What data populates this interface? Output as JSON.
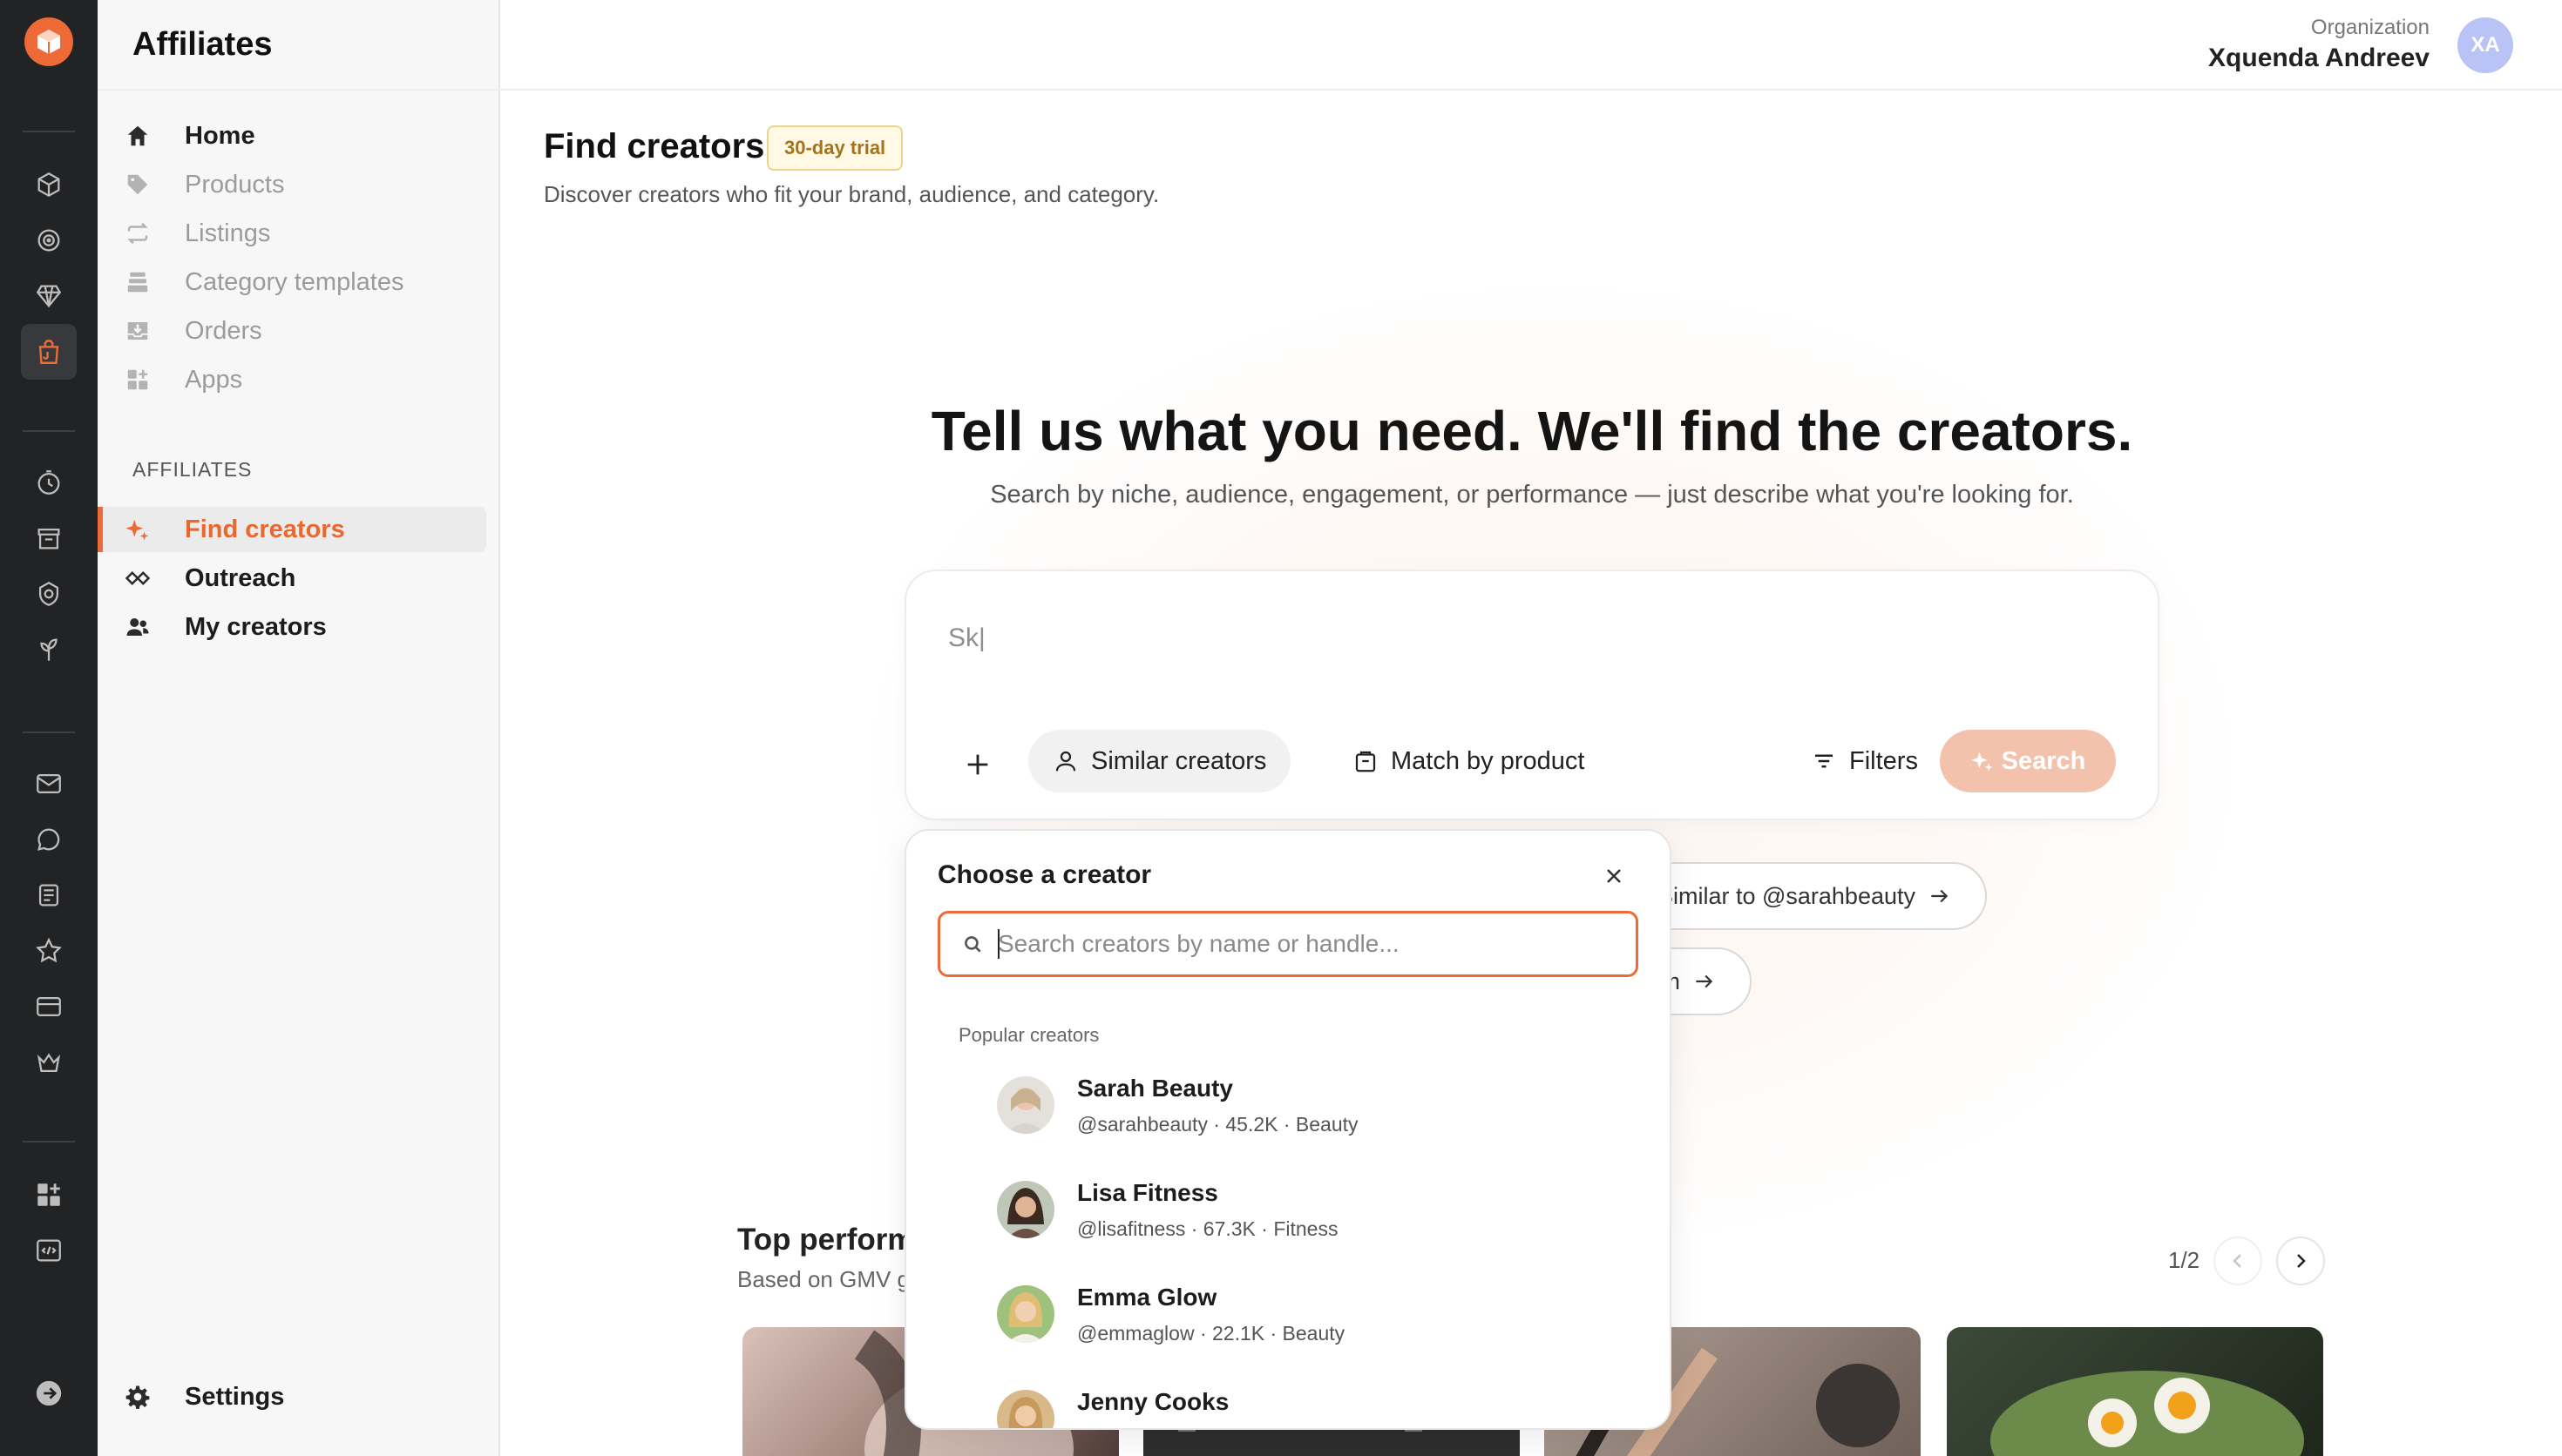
{
  "app": {
    "title": "Affiliates"
  },
  "header": {
    "org_label": "Organization",
    "org_name": "Xquenda Andreev",
    "avatar_initials": "XA"
  },
  "rail": {
    "icons": [
      "box-icon",
      "target-icon",
      "gem-icon",
      "shopping-bag-icon",
      "clock-icon",
      "archive-icon",
      "shield-icon",
      "plant-icon",
      "mail-icon",
      "chat-icon",
      "document-icon",
      "star-icon",
      "card-icon",
      "crown-icon",
      "apps-add-icon",
      "code-icon",
      "logout-icon"
    ],
    "active": "shopping-bag-icon"
  },
  "sidebar": {
    "items": [
      {
        "label": "Home",
        "icon": "home-icon"
      },
      {
        "label": "Products",
        "icon": "tag-icon"
      },
      {
        "label": "Listings",
        "icon": "repeat-icon"
      },
      {
        "label": "Category templates",
        "icon": "layers-icon"
      },
      {
        "label": "Orders",
        "icon": "inbox-icon"
      },
      {
        "label": "Apps",
        "icon": "apps-icon"
      }
    ],
    "section_label": "AFFILIATES",
    "affiliate_items": [
      {
        "label": "Find creators",
        "icon": "sparkle-icon",
        "active": true
      },
      {
        "label": "Outreach",
        "icon": "handshake-icon"
      },
      {
        "label": "My creators",
        "icon": "users-icon"
      }
    ],
    "settings_label": "Settings"
  },
  "main": {
    "title": "Find creators",
    "trial_badge": "30-day trial",
    "subtitle": "Discover creators who fit your brand, audience, and category.",
    "hero_title": "Tell us what you need. We'll find the creators.",
    "hero_subtitle": "Search by niche, audience, engagement, or performance — just describe what you're looking for.",
    "search": {
      "value": "Sk|",
      "chip_similar": "Similar creators",
      "chip_match": "Match by product",
      "filters_label": "Filters",
      "search_label": "Search"
    },
    "suggestions": [
      "Similar to @sarahbeauty",
      "m"
    ],
    "top": {
      "title": "Top perform",
      "subtitle": "Based on GMV g",
      "pager": "1/2"
    }
  },
  "popover": {
    "title": "Choose a creator",
    "search_placeholder": "Search creators by name or handle...",
    "section": "Popular creators",
    "creators": [
      {
        "name": "Sarah Beauty",
        "meta": "@sarahbeauty · 45.2K · Beauty"
      },
      {
        "name": "Lisa Fitness",
        "meta": "@lisafitness · 67.3K · Fitness"
      },
      {
        "name": "Emma Glow",
        "meta": "@emmaglow · 22.1K · Beauty"
      },
      {
        "name": "Jenny Cooks",
        "meta": ""
      }
    ]
  },
  "colors": {
    "accent": "#ee6a36",
    "rail": "#222325",
    "search_button": "#f3c2ac"
  }
}
